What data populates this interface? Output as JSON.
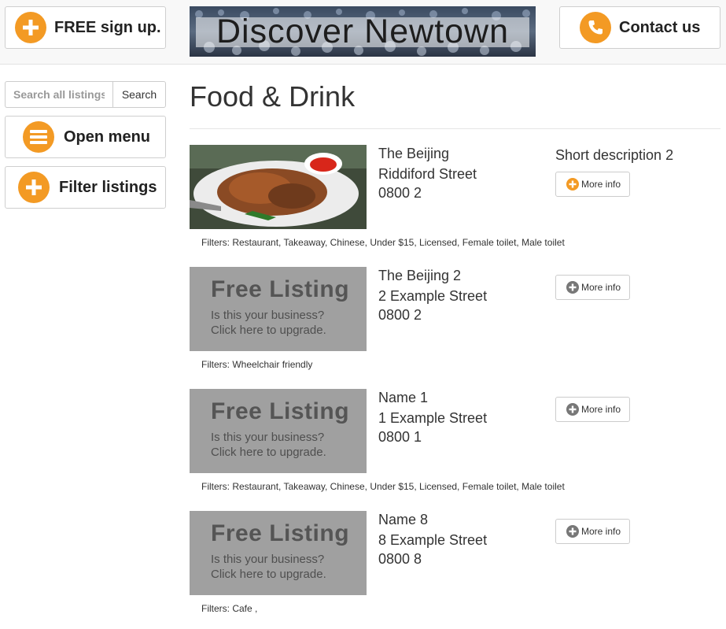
{
  "header": {
    "signup_label": "FREE sign up.",
    "banner_text": "Discover Newtown",
    "contact_label": "Contact us"
  },
  "sidebar": {
    "search_placeholder": "Search all listings",
    "search_button": "Search",
    "open_menu_label": "Open menu",
    "filter_label": "Filter listings"
  },
  "main": {
    "title": "Food & Drink",
    "more_info_label": "More info",
    "free_listing": {
      "title": "Free Listing",
      "line1": "Is this your business?",
      "line2": "Click here to upgrade."
    },
    "listings": [
      {
        "name": "The Beijing",
        "street": "Riddiford Street",
        "phone": "0800 2",
        "short": "Short description 2",
        "filters": "Filters: Restaurant, Takeaway, Chinese, Under $15, Licensed, Female toilet, Male toilet",
        "photo": true
      },
      {
        "name": "The Beijing 2",
        "street": "2 Example Street",
        "phone": "0800 2",
        "short": "",
        "filters": "Filters: Wheelchair friendly",
        "photo": false
      },
      {
        "name": "Name 1",
        "street": "1 Example Street",
        "phone": "0800 1",
        "short": "",
        "filters": "Filters: Restaurant, Takeaway, Chinese, Under $15, Licensed, Female toilet, Male toilet",
        "photo": false
      },
      {
        "name": "Name 8",
        "street": "8 Example Street",
        "phone": "0800 8",
        "short": "",
        "filters": "Filters: Cafe ,",
        "photo": false
      }
    ]
  },
  "colors": {
    "accent": "#f39a24",
    "placeholder_bg": "#a0a0a0",
    "more_info_icon_orange": "#f39a24",
    "more_info_icon_grey": "#777777"
  },
  "icons": {
    "signup": "plus-circle-icon",
    "contact": "phone-icon",
    "menu": "hamburger-icon",
    "filter": "plus-circle-icon",
    "more_info": "plus-circle-icon"
  }
}
